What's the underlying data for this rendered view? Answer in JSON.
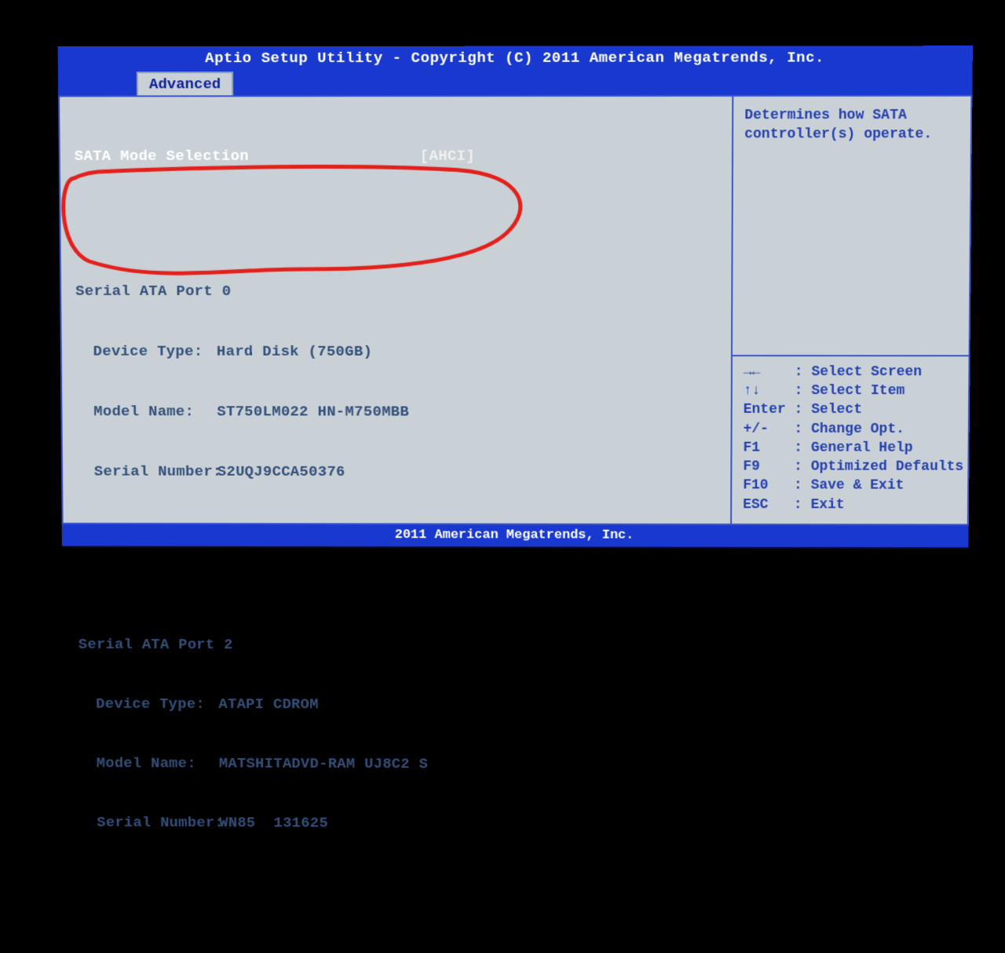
{
  "header": {
    "title": "Aptio Setup Utility - Copyright (C) 2011 American Megatrends, Inc.",
    "active_tab": "Advanced"
  },
  "main": {
    "selected_row": {
      "label": "SATA Mode Selection",
      "value": "[AHCI]"
    },
    "ports": [
      {
        "heading": "Serial ATA Port 0",
        "device_type_label": "Device Type:",
        "device_type": "Hard Disk (750GB)",
        "model_label": "Model Name:",
        "model": "ST750LM022 HN-M750MBB",
        "serial_label": "Serial Number:",
        "serial": "S2UQJ9CCA50376"
      },
      {
        "heading": "Serial ATA Port 2",
        "device_type_label": "Device Type:",
        "device_type": "ATAPI CDROM",
        "model_label": "Model Name:",
        "model": "MATSHITADVD-RAM UJ8C2 S",
        "serial_label": "Serial Number:",
        "serial": "WN85  131625"
      }
    ]
  },
  "side": {
    "help_text": "Determines how SATA controller(s) operate.",
    "keys": [
      {
        "key": "→←",
        "label": ": Select Screen"
      },
      {
        "key": "↑↓",
        "label": ": Select Item"
      },
      {
        "key": "Enter",
        "label": ": Select"
      },
      {
        "key": "+/-",
        "label": ": Change Opt."
      },
      {
        "key": "F1",
        "label": ": General Help"
      },
      {
        "key": "F9",
        "label": ": Optimized Defaults"
      },
      {
        "key": "F10",
        "label": ": Save & Exit"
      },
      {
        "key": "ESC",
        "label": ": Exit"
      }
    ]
  },
  "footer": {
    "text": "2011 American Megatrends, Inc."
  },
  "annotation": {
    "stroke": "#e2211c"
  }
}
